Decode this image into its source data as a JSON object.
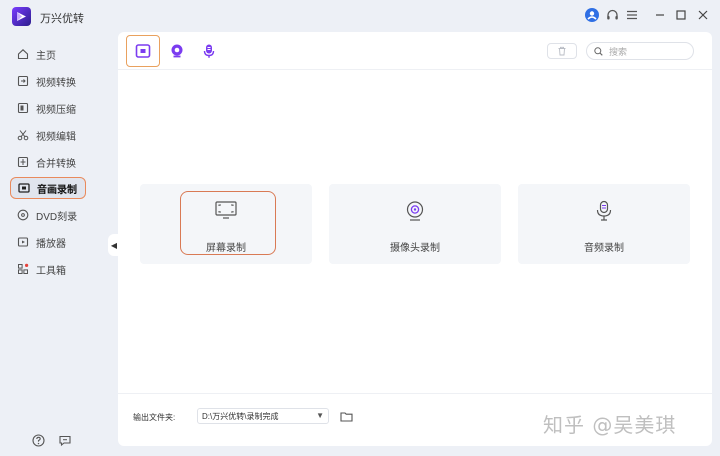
{
  "app": {
    "title": "万兴优转"
  },
  "sidebar": {
    "items": [
      {
        "label": "主页",
        "icon": "home-icon"
      },
      {
        "label": "视频转换",
        "icon": "convert-icon"
      },
      {
        "label": "视频压缩",
        "icon": "compress-icon"
      },
      {
        "label": "视频编辑",
        "icon": "scissors-icon"
      },
      {
        "label": "合并转换",
        "icon": "merge-icon"
      },
      {
        "label": "音画录制",
        "icon": "record-icon",
        "active": true
      },
      {
        "label": "DVD刻录",
        "icon": "disc-icon"
      },
      {
        "label": "播放器",
        "icon": "player-icon"
      },
      {
        "label": "工具箱",
        "icon": "toolbox-icon"
      }
    ]
  },
  "toolbar": {
    "search_placeholder": "搜索"
  },
  "cards": [
    {
      "label": "屏幕录制",
      "icon": "screen-record-icon"
    },
    {
      "label": "摄像头录制",
      "icon": "webcam-icon"
    },
    {
      "label": "音频录制",
      "icon": "microphone-icon"
    }
  ],
  "footer": {
    "output_label": "输出文件夹:",
    "output_path": "D:\\万兴优转\\录制完成"
  },
  "watermark": "知乎 @吴美琪",
  "colors": {
    "accent": "#7b3cf0",
    "highlight": "#e98a5c",
    "avatar": "#2f6fe4"
  }
}
